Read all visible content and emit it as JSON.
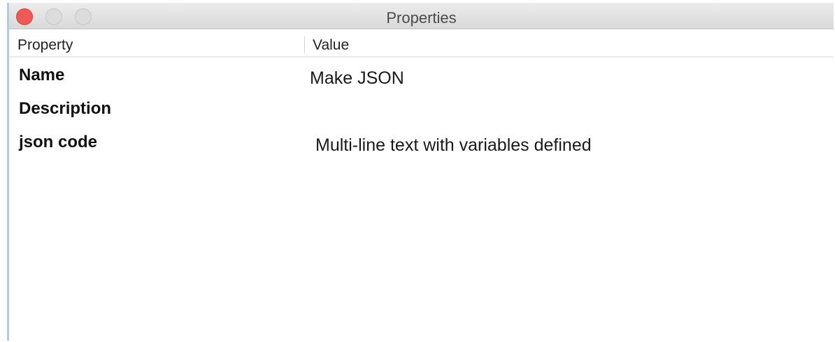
{
  "window": {
    "title": "Properties"
  },
  "table": {
    "columns": [
      "Property",
      "Value"
    ],
    "rows": [
      {
        "property": "Name",
        "value": "Make JSON"
      },
      {
        "property": "Description",
        "value": ""
      },
      {
        "property": "json code",
        "value": "Multi-line text with variables defined"
      }
    ]
  },
  "colors": {
    "close": "#ef5a57",
    "inactive_button": "#dcdcdc",
    "window_border": "#b7c9de"
  }
}
